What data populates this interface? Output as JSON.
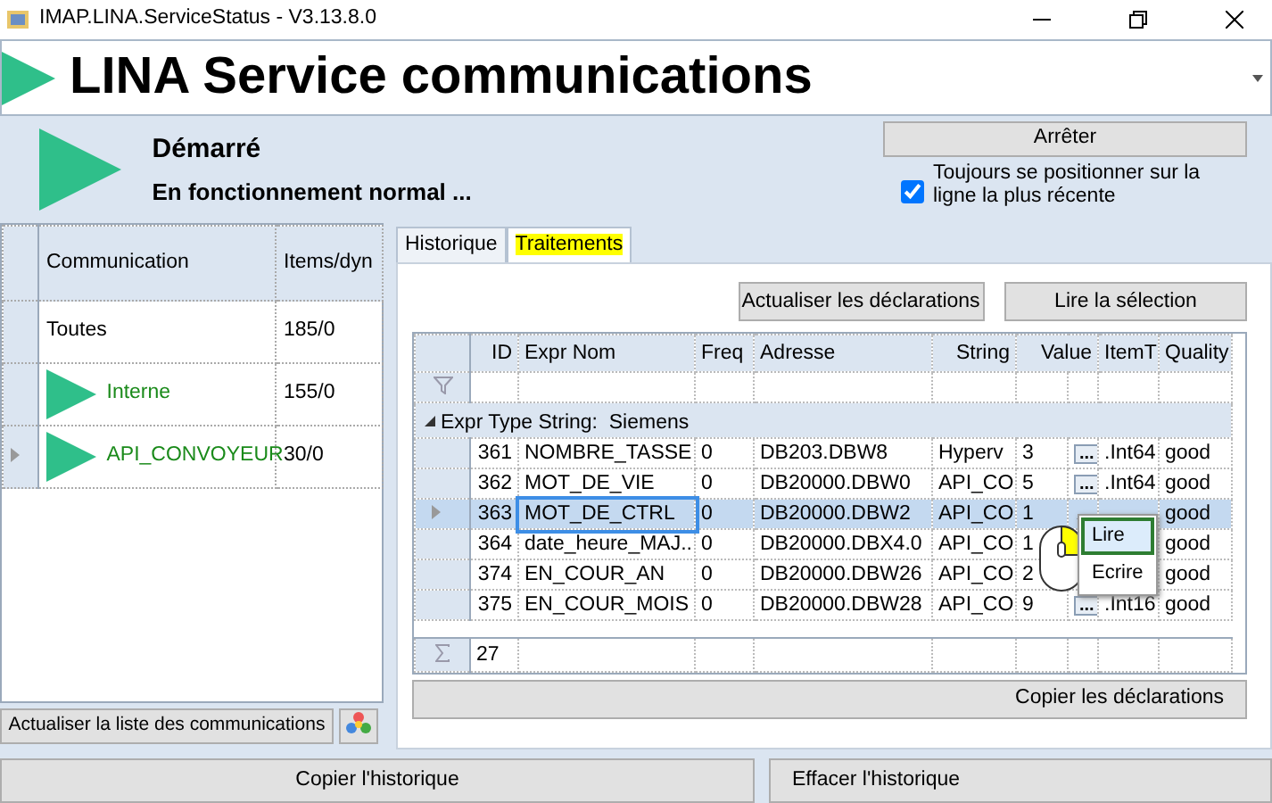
{
  "window": {
    "title": "IMAP.LINA.ServiceStatus - V3.13.8.0"
  },
  "banner": {
    "title": "LINA Service communications"
  },
  "status": {
    "state": "Démarré",
    "message": "En fonctionnement normal ...",
    "stop_button": "Arrêter",
    "auto_scroll": {
      "label": "Toujours se positionner sur la ligne la plus récente",
      "checked": true
    }
  },
  "communications": {
    "columns": [
      "Communication",
      "Items/dyn"
    ],
    "rows": [
      {
        "name": "Toutes",
        "items": "185/0",
        "running": false,
        "selected": false
      },
      {
        "name": "Interne",
        "items": "155/0",
        "running": true,
        "selected": false
      },
      {
        "name": "API_CONVOYEUR",
        "items": "30/0",
        "running": true,
        "selected": true
      }
    ],
    "refresh_button": "Actualiser la liste des communications"
  },
  "tabs": [
    {
      "label": "Historique",
      "selected": false
    },
    {
      "label": "Traitements",
      "selected": true
    }
  ],
  "toolbar": [
    "Actualiser les déclarations",
    "Lire la sélection"
  ],
  "grid": {
    "columns": [
      "ID",
      "Expr Nom",
      "Freq",
      "Adresse",
      "String",
      "Value",
      "ItemT",
      "Quality"
    ],
    "group": "Expr Type String:  Siemens",
    "rows": [
      {
        "id": "361",
        "name": "NOMBRE_TASSE",
        "freq": "0",
        "address": "DB203.DBW8",
        "string": "Hyperv",
        "value": "3",
        "button": "...",
        "item_type": ".Int64",
        "quality": "good",
        "selected": false
      },
      {
        "id": "362",
        "name": "MOT_DE_VIE",
        "freq": "0",
        "address": "DB20000.DBW0",
        "string": "API_CO",
        "value": "5",
        "button": "...",
        "item_type": ".Int64",
        "quality": "good",
        "selected": false
      },
      {
        "id": "363",
        "name": "MOT_DE_CTRL",
        "freq": "0",
        "address": "DB20000.DBW2",
        "string": "API_CO",
        "value": "1",
        "quality": "good",
        "selected": true
      },
      {
        "id": "364",
        "name": "date_heure_MAJ...",
        "freq": "0",
        "address": "DB20000.DBX4.0",
        "string": "API_CO",
        "value": "1",
        "quality": "good",
        "selected": false
      },
      {
        "id": "374",
        "name": "EN_COUR_AN",
        "freq": "0",
        "address": "DB20000.DBW26",
        "string": "API_CO",
        "value": "2",
        "quality": "good",
        "selected": false
      },
      {
        "id": "375",
        "name": "EN_COUR_MOIS",
        "freq": "0",
        "address": "DB20000.DBW28",
        "string": "API_CO",
        "value": "9",
        "button": "...",
        "item_type": ".Int16",
        "quality": "good",
        "selected": false
      }
    ],
    "footer": "27"
  },
  "copy_button": "Copier les déclarations",
  "context_menu": [
    {
      "label": "Lire",
      "selected": true
    },
    {
      "label": "Ecrire",
      "selected": false
    }
  ],
  "bottom_buttons": [
    "Copier l'historique",
    "Effacer l'historique"
  ]
}
